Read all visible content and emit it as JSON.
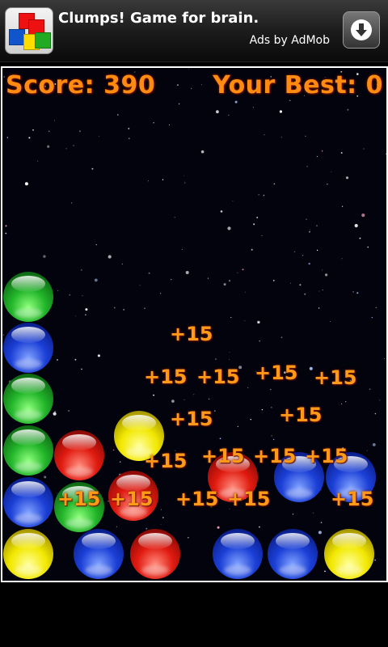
{
  "ad": {
    "title": "Clumps! Game for brain.",
    "subtitle": "Ads by AdMob",
    "icon": "colored-cubes-icon",
    "download_icon": "download-arrow-icon"
  },
  "hud": {
    "score_text": "Score: 390",
    "best_text": "Your Best: 0"
  },
  "colors": {
    "hud_text": "#ff8c10",
    "points_text": "#ff9a18",
    "ball_colors": [
      "green",
      "blue",
      "red",
      "yellow"
    ]
  },
  "balls_by_column": [
    [
      "yellow",
      "blue",
      "green",
      "green",
      "blue",
      "green"
    ],
    [
      "",
      "green",
      "red"
    ],
    [
      "blue",
      "red"
    ],
    [
      "red"
    ],
    [
      "blue"
    ],
    [
      "blue"
    ],
    [
      "yellow",
      "blue"
    ]
  ],
  "points_label": "+15",
  "points_popups_count": 17
}
